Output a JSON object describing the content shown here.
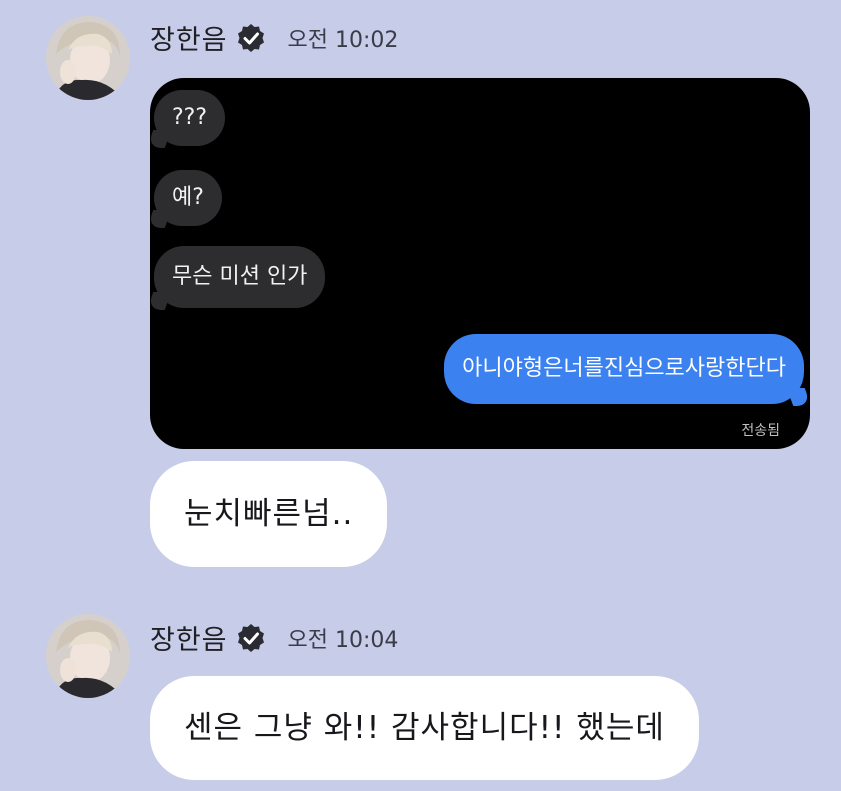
{
  "messages": [
    {
      "sender": "장한음",
      "time": "오전 10:02",
      "screenshot": {
        "incoming": [
          "???",
          "예?",
          "무슨 미션 인가"
        ],
        "outgoing": "아니야형은너를진심으로사랑한단다",
        "status": "전송됨"
      },
      "text": "눈치빠른넘.."
    },
    {
      "sender": "장한음",
      "time": "오전 10:04",
      "text": "센은 그냥 와!! 감사합니다!! 했는데"
    }
  ],
  "colors": {
    "background": "#c7cce8",
    "bubble": "#ffffff",
    "outgoing_blue": "#3b82f0",
    "incoming_gray": "#2d2d30"
  },
  "icons": [
    "verified-badge-icon"
  ]
}
